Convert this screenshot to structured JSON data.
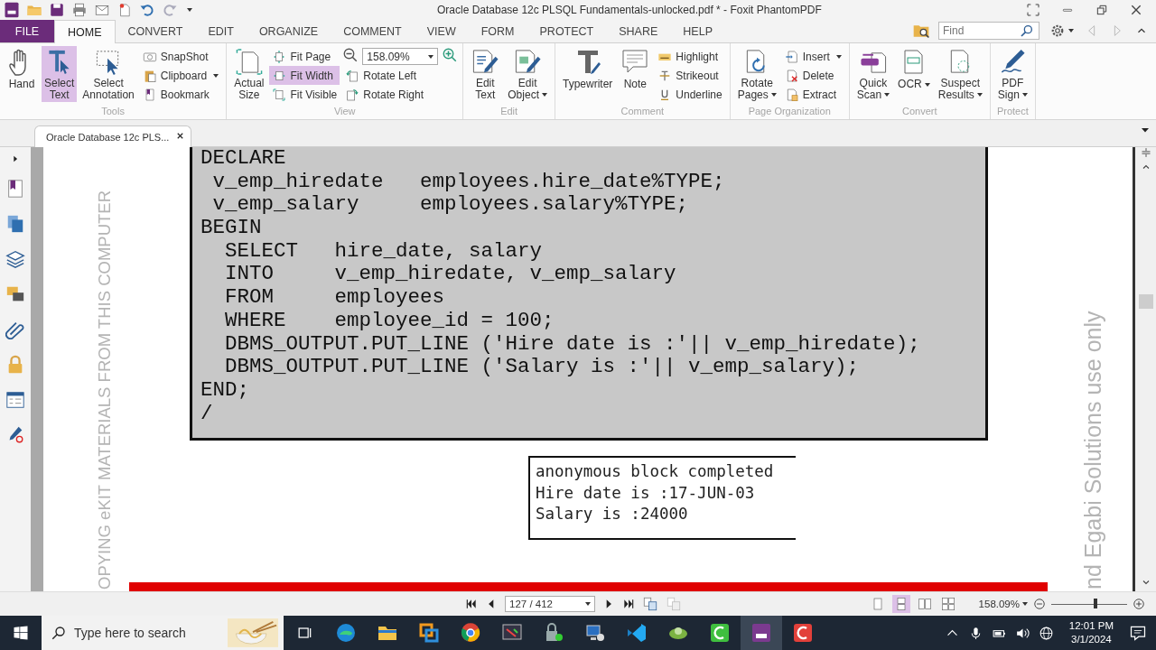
{
  "window": {
    "title": "Oracle Database 12c PLSQL Fundamentals-unlocked.pdf * - Foxit PhantomPDF"
  },
  "ribbon_tabs": [
    {
      "label": "FILE",
      "kind": "file",
      "selected": false
    },
    {
      "label": "HOME",
      "kind": "tab",
      "selected": true
    },
    {
      "label": "CONVERT",
      "kind": "tab",
      "selected": false
    },
    {
      "label": "EDIT",
      "kind": "tab",
      "selected": false
    },
    {
      "label": "ORGANIZE",
      "kind": "tab",
      "selected": false
    },
    {
      "label": "COMMENT",
      "kind": "tab",
      "selected": false
    },
    {
      "label": "VIEW",
      "kind": "tab",
      "selected": false
    },
    {
      "label": "FORM",
      "kind": "tab",
      "selected": false
    },
    {
      "label": "PROTECT",
      "kind": "tab",
      "selected": false
    },
    {
      "label": "SHARE",
      "kind": "tab",
      "selected": false
    },
    {
      "label": "HELP",
      "kind": "tab",
      "selected": false
    }
  ],
  "find": {
    "placeholder": "Find"
  },
  "ribbon_groups": [
    {
      "label": "Tools",
      "columns": [
        {
          "kind": "large",
          "label": "Hand",
          "dropdown": false,
          "selected": false
        },
        {
          "kind": "large",
          "label": "Select\nText",
          "dropdown": false,
          "selected": true
        },
        {
          "kind": "large",
          "label": "Select\nAnnotation",
          "dropdown": false,
          "selected": false
        },
        {
          "kind": "stack",
          "items": [
            {
              "kind": "button",
              "label": "SnapShot",
              "dropdown": false,
              "selected": false
            },
            {
              "kind": "button",
              "label": "Clipboard",
              "dropdown": true,
              "selected": false
            },
            {
              "kind": "button",
              "label": "Bookmark",
              "dropdown": false,
              "selected": false
            }
          ]
        }
      ]
    },
    {
      "label": "View",
      "columns": [
        {
          "kind": "large",
          "label": "Actual\nSize",
          "dropdown": false,
          "selected": false
        },
        {
          "kind": "stack",
          "items": [
            {
              "kind": "button",
              "label": "Fit Page",
              "dropdown": false,
              "selected": false
            },
            {
              "kind": "button",
              "label": "Fit Width",
              "dropdown": false,
              "selected": true
            },
            {
              "kind": "button",
              "label": "Fit Visible",
              "dropdown": false,
              "selected": false
            }
          ]
        },
        {
          "kind": "stack",
          "items": [
            {
              "kind": "zoom",
              "value": "158.09%"
            },
            {
              "kind": "button",
              "label": "Rotate Left",
              "dropdown": false,
              "selected": false
            },
            {
              "kind": "button",
              "label": "Rotate Right",
              "dropdown": false,
              "selected": false
            }
          ]
        }
      ]
    },
    {
      "label": "Edit",
      "columns": [
        {
          "kind": "large",
          "label": "Edit\nText",
          "dropdown": false,
          "selected": false
        },
        {
          "kind": "large",
          "label": "Edit\nObject",
          "dropdown": true,
          "selected": false
        }
      ]
    },
    {
      "label": "Comment",
      "columns": [
        {
          "kind": "large",
          "label": "Typewriter",
          "dropdown": false,
          "selected": false
        },
        {
          "kind": "large",
          "label": "Note",
          "dropdown": false,
          "selected": false
        },
        {
          "kind": "stack",
          "items": [
            {
              "kind": "button",
              "label": "Highlight",
              "dropdown": false,
              "selected": false
            },
            {
              "kind": "button",
              "label": "Strikeout",
              "dropdown": false,
              "selected": false
            },
            {
              "kind": "button",
              "label": "Underline",
              "dropdown": false,
              "selected": false
            }
          ]
        }
      ]
    },
    {
      "label": "Page Organization",
      "columns": [
        {
          "kind": "large",
          "label": "Rotate\nPages",
          "dropdown": true,
          "selected": false
        },
        {
          "kind": "stack",
          "items": [
            {
              "kind": "button",
              "label": "Insert",
              "dropdown": true,
              "selected": false
            },
            {
              "kind": "button",
              "label": "Delete",
              "dropdown": false,
              "selected": false
            },
            {
              "kind": "button",
              "label": "Extract",
              "dropdown": false,
              "selected": false
            }
          ]
        }
      ]
    },
    {
      "label": "Convert",
      "columns": [
        {
          "kind": "large",
          "label": "Quick\nScan",
          "dropdown": true,
          "selected": false
        },
        {
          "kind": "large",
          "label": "OCR",
          "dropdown": true,
          "selected": false
        },
        {
          "kind": "large",
          "label": "Suspect\nResults",
          "dropdown": true,
          "selected": false
        }
      ]
    },
    {
      "label": "Protect",
      "columns": [
        {
          "kind": "large",
          "label": "PDF\nSign",
          "dropdown": true,
          "selected": false
        }
      ]
    }
  ],
  "document_tab": {
    "title": "Oracle Database 12c PLS..."
  },
  "document": {
    "side_text_left": "OPYING eKIT MATERIALS FROM THIS COMPUTER",
    "side_text_right": "nd Egabi Solutions use only",
    "code_lines": [
      "DECLARE",
      " v_emp_hiredate   employees.hire_date%TYPE;",
      " v_emp_salary     employees.salary%TYPE;",
      "BEGIN",
      "  SELECT   hire_date, salary",
      "  INTO     v_emp_hiredate, v_emp_salary",
      "  FROM     employees",
      "  WHERE    employee_id = 100;",
      "  DBMS_OUTPUT.PUT_LINE ('Hire date is :'|| v_emp_hiredate);",
      "  DBMS_OUTPUT.PUT_LINE ('Salary is :'|| v_emp_salary);",
      "END;",
      "/"
    ],
    "output_lines": [
      "anonymous block completed",
      "Hire date is :17-JUN-03",
      "Salary is :24000"
    ]
  },
  "status_bar": {
    "page": "127 / 412",
    "zoom": "158.09%",
    "zoom_slider": {
      "level": 0.58
    },
    "view_modes": [
      {
        "selected": false
      },
      {
        "selected": true
      },
      {
        "selected": false
      },
      {
        "selected": false
      }
    ]
  },
  "taskbar": {
    "search_placeholder": "Type here to search",
    "time": "12:01 PM",
    "date": "3/1/2024",
    "apps": [
      {
        "active": false
      },
      {
        "active": false
      },
      {
        "active": false
      },
      {
        "active": false
      },
      {
        "active": false
      },
      {
        "active": false
      },
      {
        "active": false
      },
      {
        "active": false
      },
      {
        "active": false
      },
      {
        "active": false
      },
      {
        "active": true
      },
      {
        "active": false
      }
    ]
  }
}
